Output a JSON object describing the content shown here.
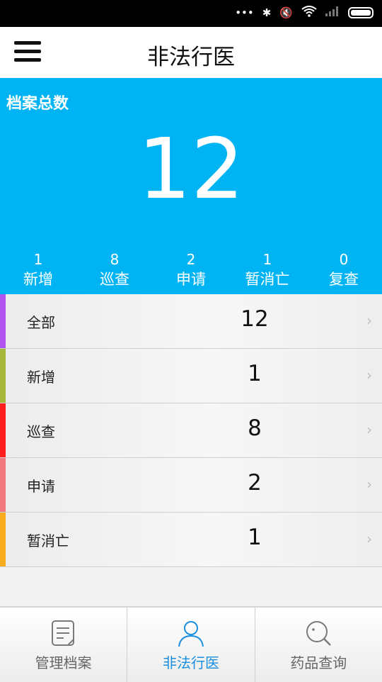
{
  "header": {
    "title": "非法行医"
  },
  "summary": {
    "label": "档案总数",
    "total": "12"
  },
  "stats": [
    {
      "count": "1",
      "label": "新增"
    },
    {
      "count": "8",
      "label": "巡查"
    },
    {
      "count": "2",
      "label": "申请"
    },
    {
      "count": "1",
      "label": "暂消亡"
    },
    {
      "count": "0",
      "label": "复查"
    }
  ],
  "list": [
    {
      "label": "全部",
      "value": "12",
      "color": "#b054f0"
    },
    {
      "label": "新增",
      "value": "1",
      "color": "#a6b83a"
    },
    {
      "label": "巡查",
      "value": "8",
      "color": "#ff1e1e"
    },
    {
      "label": "申请",
      "value": "2",
      "color": "#f07a80"
    },
    {
      "label": "暂消亡",
      "value": "1",
      "color": "#f6ac1e"
    }
  ],
  "tabs": [
    {
      "label": "管理档案",
      "icon": "document-icon",
      "active": false
    },
    {
      "label": "非法行医",
      "icon": "person-icon",
      "active": true
    },
    {
      "label": "药品查询",
      "icon": "search-icon",
      "active": false
    }
  ],
  "colors": {
    "accent": "#00b4f4",
    "tab_active": "#1a8fe0"
  }
}
